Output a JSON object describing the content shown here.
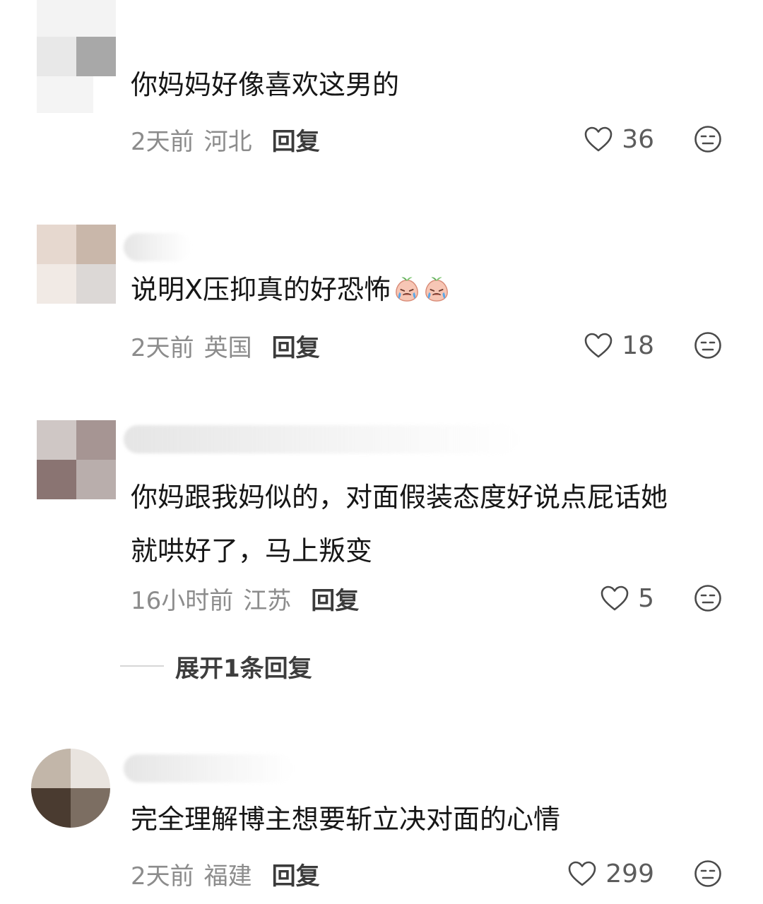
{
  "comments": [
    {
      "text": "你妈妈好像喜欢这男的",
      "time": "2天前",
      "location": "河北",
      "reply_label": "回复",
      "likes": "36"
    },
    {
      "text": "说明X压抑真的好恐怖",
      "emoji": [
        "crying-peach-emoji",
        "crying-peach-emoji"
      ],
      "time": "2天前",
      "location": "英国",
      "reply_label": "回复",
      "likes": "18"
    },
    {
      "text": "你妈跟我妈似的，对面假装态度好说点屁话她\n就哄好了，马上叛变",
      "time": "16小时前",
      "location": "江苏",
      "reply_label": "回复",
      "likes": "5",
      "expand_replies": "展开1条回复"
    },
    {
      "text": "完全理解博主想要斩立决对面的心情",
      "time": "2天前",
      "location": "福建",
      "reply_label": "回复",
      "likes": "299"
    }
  ],
  "colors": {
    "meta_text": "#8c8c8c",
    "reply_text": "#3b3b3b",
    "icon_stroke": "#4a4a4a"
  },
  "icons": {
    "like": "heart-icon",
    "dislike": "unamused-face-icon"
  }
}
